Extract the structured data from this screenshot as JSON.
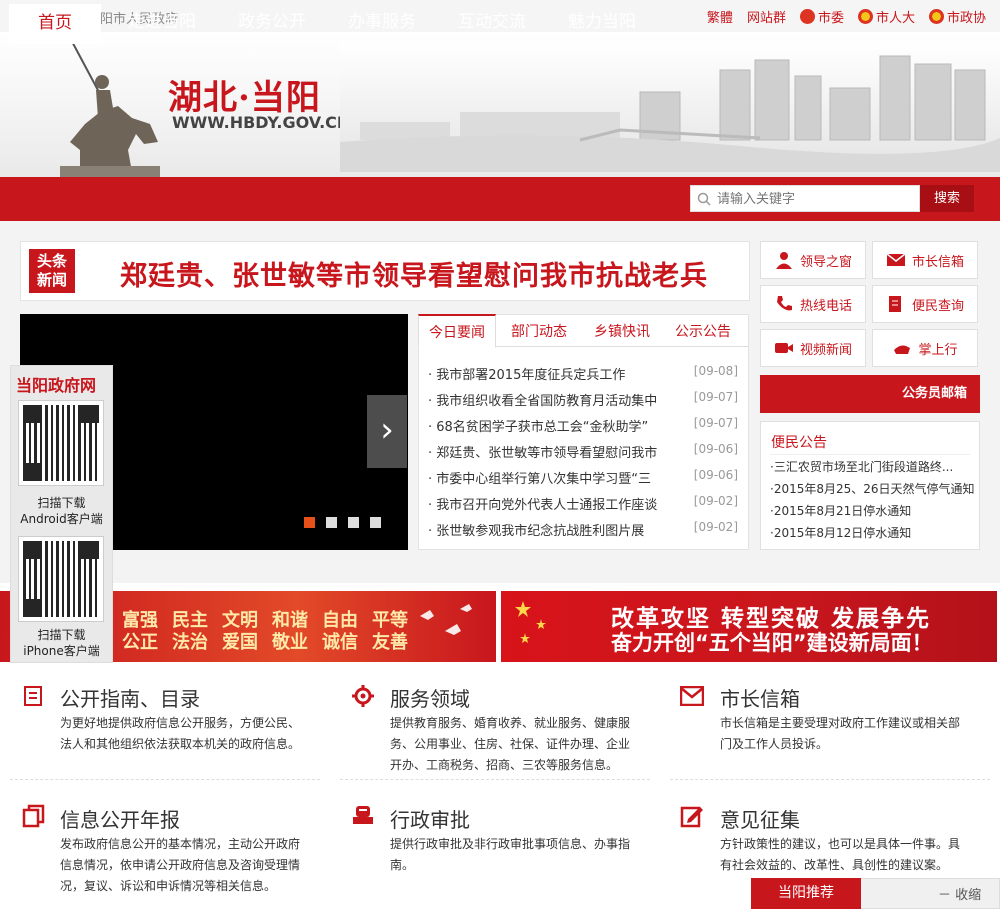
{
  "topbar": {
    "host": "主办单位：当阳市人民政府",
    "links": [
      "繁體",
      "网站群",
      "市委",
      "市人大",
      "市政协"
    ]
  },
  "header": {
    "title": "湖北·当阳",
    "url": "WWW.HBDY.GOV.CN"
  },
  "nav": {
    "items": [
      "首页",
      "走进当阳",
      "政务公开",
      "办事服务",
      "互动交流",
      "魅力当阳"
    ],
    "search_placeholder": "请输入关键字",
    "search_button": "搜索"
  },
  "headline": {
    "tag_line1": "头条",
    "tag_line2": "新闻",
    "text": "郑廷贵、张世敏等市领导看望慰问我市抗战老兵"
  },
  "news": {
    "tabs": [
      "今日要闻",
      "部门动态",
      "乡镇快讯",
      "公示公告"
    ],
    "items": [
      {
        "title": "· 我市部署2015年度征兵定兵工作",
        "date": "[09-08]"
      },
      {
        "title": "· 我市组织收看全省国防教育月活动集中",
        "date": "[09-07]"
      },
      {
        "title": "· 68名贫困学子获市总工会“金秋助学”",
        "date": "[09-07]"
      },
      {
        "title": "· 郑廷贵、张世敏等市领导看望慰问我市",
        "date": "[09-06]"
      },
      {
        "title": "· 市委中心组举行第八次集中学习暨“三",
        "date": "[09-06]"
      },
      {
        "title": "· 我市召开向党外代表人士通报工作座谈",
        "date": "[09-02]"
      },
      {
        "title": "· 张世敏参观我市纪念抗战胜利图片展",
        "date": "[09-02]"
      }
    ]
  },
  "quick": [
    "领导之窗",
    "市长信箱",
    "热线电话",
    "便民查询",
    "视频新闻",
    "掌上行"
  ],
  "mail_button": "公务员邮箱",
  "notice": {
    "title": "便民公告",
    "items": [
      "·三汇农贸市场至北门街段道路终...",
      "·2015年8月25、26日天然气停气通知",
      "·2015年8月21日停水通知",
      "·2015年8月12日停水通知"
    ]
  },
  "float": {
    "title": "当阳政府网",
    "android_line1": "扫描下载",
    "android_line2": "Android客户端",
    "iphone_line1": "扫描下载",
    "iphone_line2": "iPhone客户端"
  },
  "banner1": {
    "row1": [
      "富强",
      "民主",
      "文明",
      "和谐",
      "自由",
      "平等"
    ],
    "row2": [
      "公正",
      "法治",
      "爱国",
      "敬业",
      "诚信",
      "友善"
    ]
  },
  "banner2": {
    "line1": "改革攻坚  转型突破  发展争先",
    "line2": "奋力开创“五个当阳”建设新局面！"
  },
  "services": [
    {
      "title": "公开指南、目录",
      "desc": "为更好地提供政府信息公开服务，方便公民、法人和其他组织依法获取本机关的政府信息。"
    },
    {
      "title": "服务领域",
      "desc": "提供教育服务、婚育收养、就业服务、健康服务、公用事业、住房、社保、证件办理、企业开办、工商税务、招商、三农等服务信息。"
    },
    {
      "title": "市长信箱",
      "desc": "市长信箱是主要受理对政府工作建议或相关部门及工作人员投诉。"
    },
    {
      "title": "信息公开年报",
      "desc": "发布政府信息公开的基本情况，主动公开政府信息情况，依申请公开政府信息及咨询受理情况，复议、诉讼和申诉情况等相关信息。"
    },
    {
      "title": "行政审批",
      "desc": "提供行政审批及非行政审批事项信息、办事指南。"
    },
    {
      "title": "意见征集",
      "desc": "方针政策性的建议，也可以是具体一件事。具有社会效益的、改革性、具创性的建议案。"
    }
  ],
  "bottom": {
    "recommend": "当阳推荐",
    "collapse": "－ 收缩"
  },
  "colors": {
    "brand_red": "#c8161d",
    "dark_red": "#a80f15"
  }
}
